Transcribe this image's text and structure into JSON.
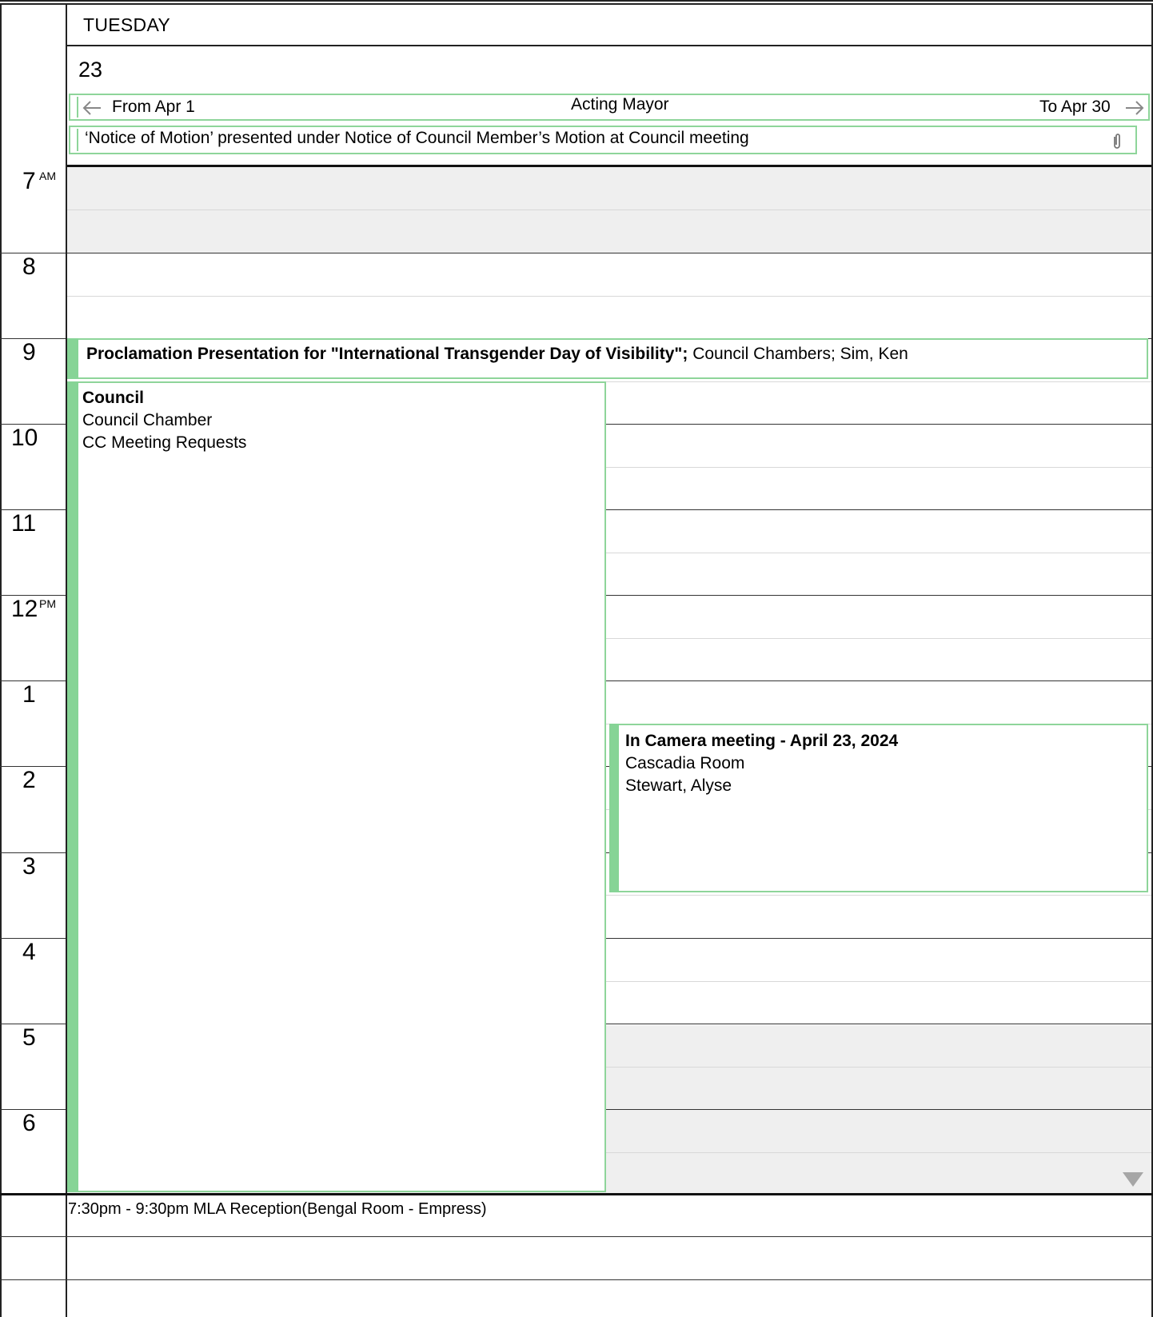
{
  "header": {
    "day_name": "TUESDAY",
    "date_number": "23"
  },
  "banners": {
    "acting_mayor": {
      "from_label": "From Apr 1",
      "title": "Acting Mayor",
      "to_label": "To Apr 30"
    },
    "notice": {
      "text": "‘Notice of Motion’ presented under Notice of Council Member’s Motion at Council meeting"
    }
  },
  "time_labels": [
    {
      "hour": "7",
      "suffix": "AM"
    },
    {
      "hour": "8",
      "suffix": ""
    },
    {
      "hour": "9",
      "suffix": ""
    },
    {
      "hour": "10",
      "suffix": ""
    },
    {
      "hour": "11",
      "suffix": ""
    },
    {
      "hour": "12",
      "suffix": "PM"
    },
    {
      "hour": "1",
      "suffix": ""
    },
    {
      "hour": "2",
      "suffix": ""
    },
    {
      "hour": "3",
      "suffix": ""
    },
    {
      "hour": "4",
      "suffix": ""
    },
    {
      "hour": "5",
      "suffix": ""
    },
    {
      "hour": "6",
      "suffix": ""
    }
  ],
  "events": {
    "proclamation": {
      "title": "Proclamation Presentation for \"International Transgender Day of Visibility\";",
      "details": "Council Chambers; Sim, Ken"
    },
    "council": {
      "title": "Council",
      "location": "Council Chamber",
      "organizer": "CC Meeting Requests"
    },
    "in_camera": {
      "title": "In Camera meeting - April 23, 2024",
      "location": "Cascadia Room",
      "organizer": "Stewart, Alyse"
    }
  },
  "evening_notes": {
    "line1": "7:30pm - 9:30pm MLA Reception(Bengal Room - Empress)"
  },
  "colors": {
    "event_border": "#8ed59a",
    "event_bar": "#86d496",
    "offhours_bg": "#efefef"
  },
  "icons": {
    "attachment": "paperclip-icon",
    "arrow_left": "arrow-left-icon",
    "arrow_right": "arrow-right-icon",
    "scroll": "scroll-down-triangle-icon"
  }
}
